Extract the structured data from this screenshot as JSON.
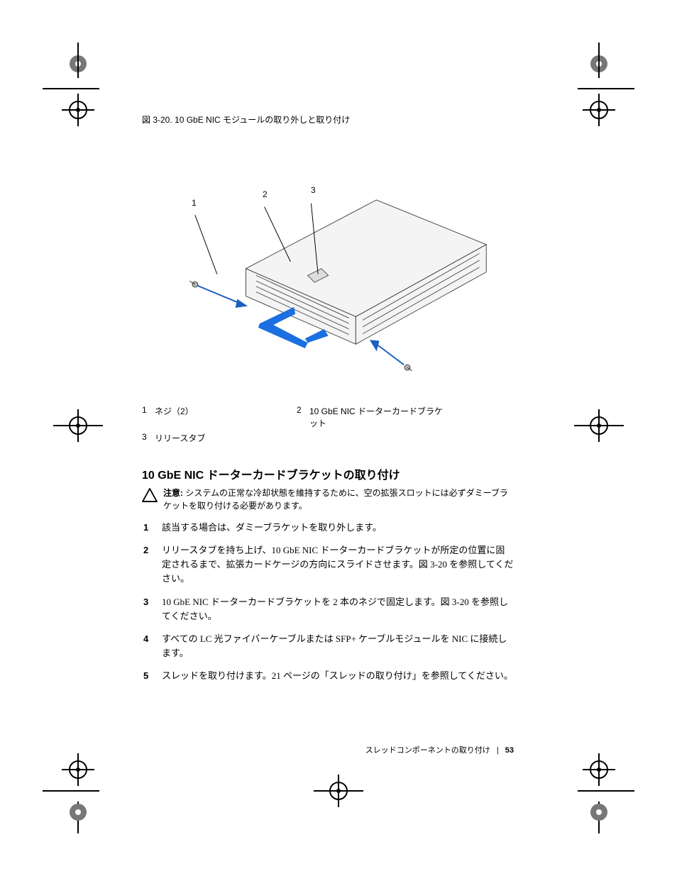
{
  "figure": {
    "caption": "図 3-20. 10 GbE NIC モジュールの取り外しと取り付け",
    "callouts": {
      "c1": {
        "num": "1",
        "label": "ネジ（2）"
      },
      "c2": {
        "num": "2",
        "label": "10 GbE NIC ドーターカードブラケット"
      },
      "c3": {
        "num": "3",
        "label": "リリースタブ"
      }
    }
  },
  "legend": {
    "rows": [
      {
        "n": "1",
        "t": "ネジ（2）",
        "n2": "2",
        "t2": "10 GbE NIC ドーターカードブラケット"
      },
      {
        "n": "3",
        "t": "リリースタブ",
        "n2": "",
        "t2": ""
      }
    ]
  },
  "section_heading": "10 GbE NIC ドーターカードブラケットの取り付け",
  "caution": {
    "label": "注意:",
    "text": " システムの正常な冷却状態を維持するために、空の拡張スロットには必ずダミーブラケットを取り付ける必要があります。"
  },
  "steps": [
    "該当する場合は、ダミーブラケットを取り外します。",
    "リリースタブを持ち上げ、10 GbE NIC ドーターカードブラケットが所定の位置に固定されるまで、拡張カードケージの方向にスライドさせます。図 3-20 を参照してください。",
    "10 GbE NIC ドーターカードブラケットを 2 本のネジで固定します。図 3-20 を参照してください。",
    "すべての LC 光ファイバーケーブルまたは SFP+ ケーブルモジュールを NIC に接続します。",
    "スレッドを取り付けます。21 ページの「スレッドの取り付け」を参照してください。"
  ],
  "footer": {
    "section": "スレッドコンポーネントの取り付け",
    "sep": "|",
    "page": "53"
  }
}
